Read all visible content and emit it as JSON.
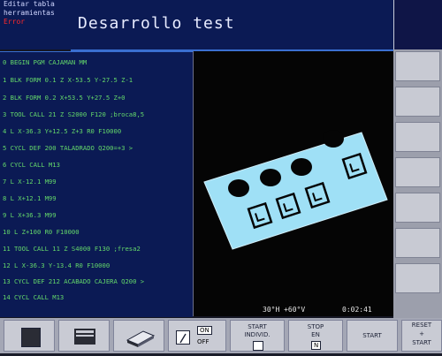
{
  "header": {
    "left_lines": [
      "Editar tabla",
      "herramientas",
      "Error"
    ],
    "title": "Desarrollo test"
  },
  "program": {
    "lines": [
      "0  BEGIN PGM CAJAMAN MM",
      "1  BLK FORM 0.1 Z  X-53.5  Y-27.5  Z-1",
      "2  BLK FORM 0.2  X+53.5  Y+27.5  Z+0",
      "3  TOOL CALL 21 Z S2000 F120 ;broca8,5",
      "4  L  X-36.3  Y+12.5  Z+3 R0 F10000",
      "5  CYCL DEF 200 TALADRADO Q200=+3  >",
      "6  CYCL CALL M13",
      "7  L  X-12.1 M99",
      "8  L  X+12.1 M99",
      "9  L  X+36.3 M99",
      "10 L  Z+100 R0 F10000",
      "11 TOOL CALL 11 Z S4000 F130 ;fresa2",
      "12 L  X-36.3  Y-13.4 R0 F10000",
      "13 CYCL DEF 212 ACABADO CAJERA Q200 >",
      "14 CYCL CALL M13"
    ]
  },
  "graphic": {
    "view_angle": "30°H  +60°V",
    "time": "0:02:41",
    "colors": {
      "part": "#9fe0f6",
      "background": "#050505"
    }
  },
  "softkeys": {
    "on_label": "ON",
    "off_label": "OFF",
    "start_individ": [
      "START",
      "INDIVID."
    ],
    "stop_en": [
      "STOP",
      "EN"
    ],
    "stop_n": "N",
    "start": "START",
    "reset_start": [
      "RESET",
      "+",
      "START"
    ]
  }
}
